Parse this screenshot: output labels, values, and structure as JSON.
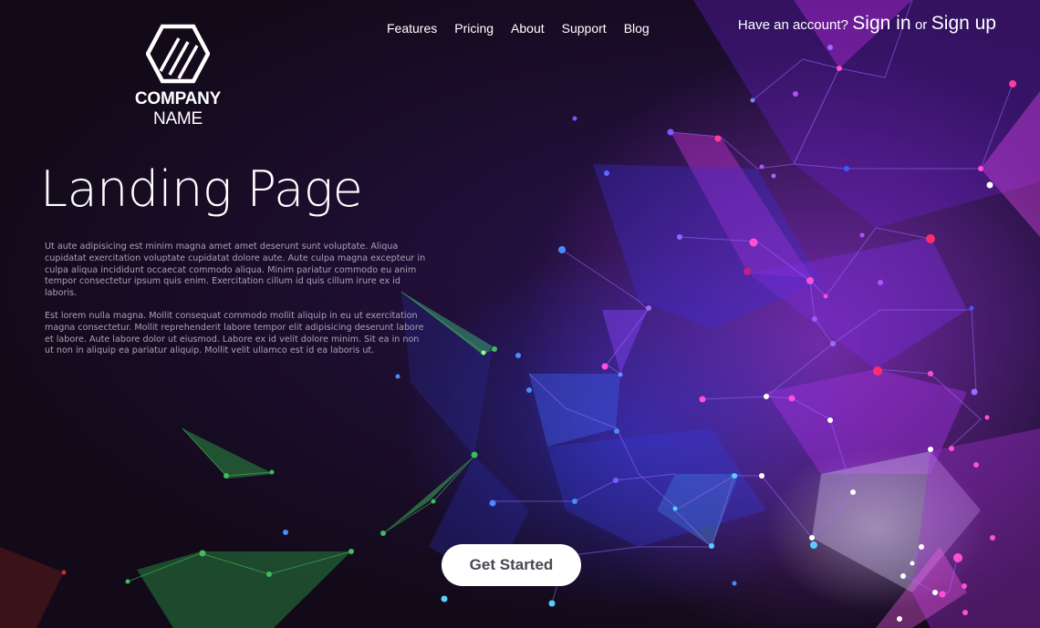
{
  "brand": {
    "logo_icon": "hexagon-slash-icon",
    "name_bold": "COMPANY",
    "name_light": " NAME"
  },
  "nav": {
    "items": [
      {
        "label": "Features"
      },
      {
        "label": "Pricing"
      },
      {
        "label": "About"
      },
      {
        "label": "Support"
      },
      {
        "label": "Blog"
      }
    ]
  },
  "account": {
    "prompt": "Have an account?",
    "sign_in": "Sign in",
    "or": "or",
    "sign_up": "Sign up"
  },
  "hero": {
    "title": "Landing Page",
    "paragraphs": [
      "Ut aute adipisicing est minim magna amet amet deserunt sunt voluptate. Aliqua cupidatat exercitation voluptate cupidatat dolore aute. Aute culpa magna excepteur in culpa aliqua incididunt occaecat commodo aliqua. Minim pariatur commodo eu anim tempor consectetur ipsum quis enim. Exercitation cillum id quis cillum irure ex id laboris.",
      "Est lorem nulla magna. Mollit consequat commodo mollit aliquip in eu ut exercitation magna consectetur. Mollit reprehenderit labore tempor elit adipisicing deserunt labore et labore. Aute labore dolor ut eiusmod. Labore ex id velit dolore minim. Sit ea in non ut non in aliquip ea pariatur aliquip. Mollit velit ullamco est id ea laboris ut."
    ],
    "cta_label": "Get Started"
  },
  "colors": {
    "background": "#150c1e",
    "purple": "#8a2be2",
    "magenta": "#e040fb",
    "blue": "#3a3cf0",
    "green": "#2faa4a",
    "text_muted": "#a8a2b6"
  }
}
